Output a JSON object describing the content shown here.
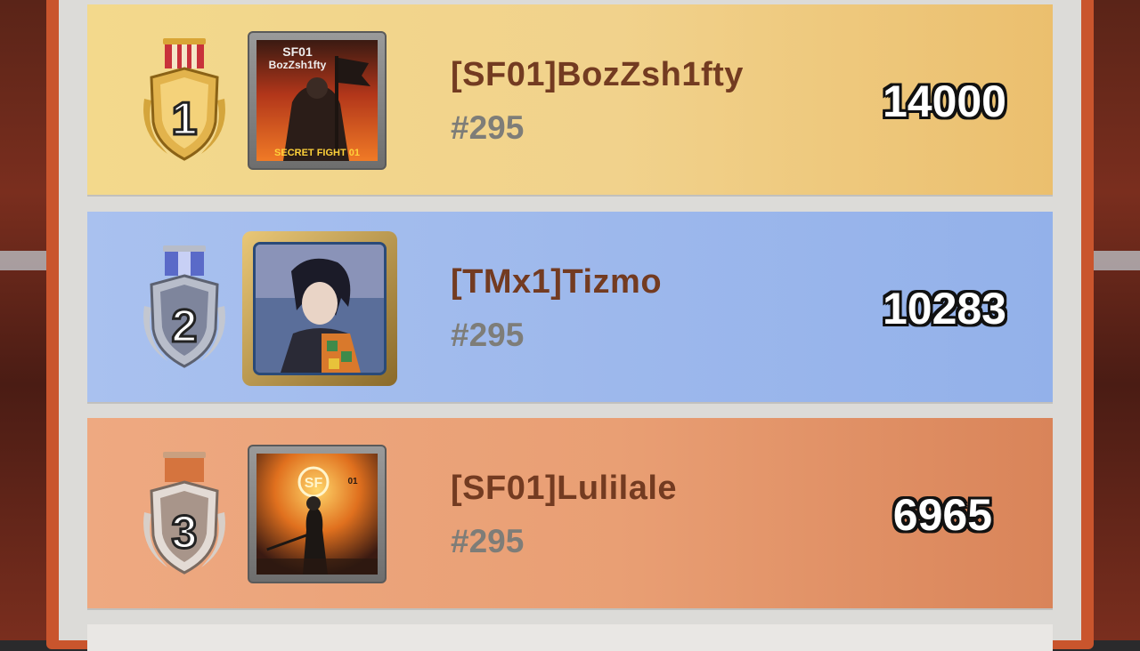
{
  "leaderboard": {
    "entries": [
      {
        "rank": "1",
        "medal": "gold-medal-icon",
        "name": "[SF01]BozZsh1fty",
        "server": "#295",
        "score": "14000",
        "avatar_text_top": "SF01",
        "avatar_text_mid": "BozZsh1fty",
        "avatar_text_bottom": "SECRET FIGHT 01",
        "row_color": "#f1d28c"
      },
      {
        "rank": "2",
        "medal": "silver-medal-icon",
        "name": "[TMx1]Tizmo",
        "server": "#295",
        "score": "10283",
        "row_color": "#9db8ec"
      },
      {
        "rank": "3",
        "medal": "bronze-medal-icon",
        "name": "[SF01]Lulilale",
        "server": "#295",
        "score": "6965",
        "avatar_text_top": "SF",
        "avatar_text_side": "01",
        "row_color": "#e99f74"
      }
    ]
  }
}
